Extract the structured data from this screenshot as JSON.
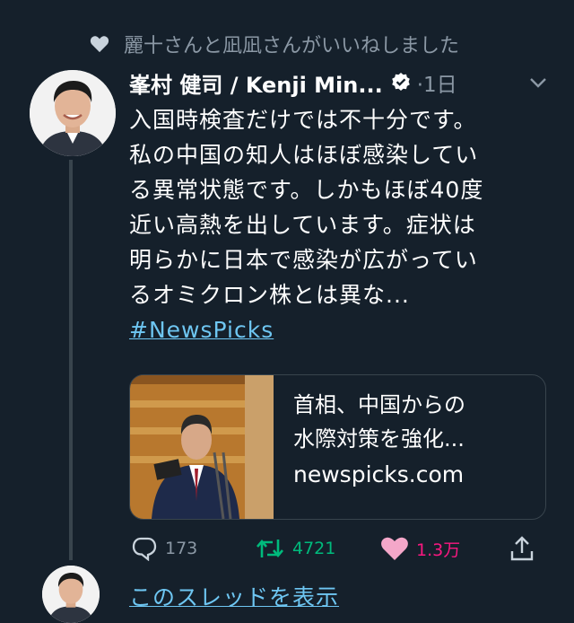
{
  "social_context": {
    "text": "麗十さんと凪凪さんがいいねしました",
    "icon": "heart-icon"
  },
  "author": {
    "display_name": "峯村 健司 / Kenji Min...",
    "verified": true
  },
  "timestamp": "·1日",
  "tweet": {
    "lines": [
      "入国時検査だけでは不十分です。",
      "私の中国の知人はほぼ感染してい",
      "る異常状態です。しかもほぼ40度",
      "近い高熱を出しています。症状は",
      "明らかに日本で感染が広がってい",
      "るオミクロン株とは異な..."
    ],
    "hashtag": "#NewsPicks"
  },
  "link_card": {
    "title_lines": [
      "首相、中国からの",
      "水際対策を強化..."
    ],
    "domain": "newspicks.com"
  },
  "actions": {
    "reply_count": "173",
    "retweet_count": "4721",
    "like_count": "1.3万"
  },
  "show_thread": "このスレッドを表示",
  "colors": {
    "background": "#15202b",
    "secondary_text": "#8b98a5",
    "link": "#6ec6f2",
    "retweet": "#00ba7c",
    "like": "#f91880",
    "border": "#38444d"
  }
}
